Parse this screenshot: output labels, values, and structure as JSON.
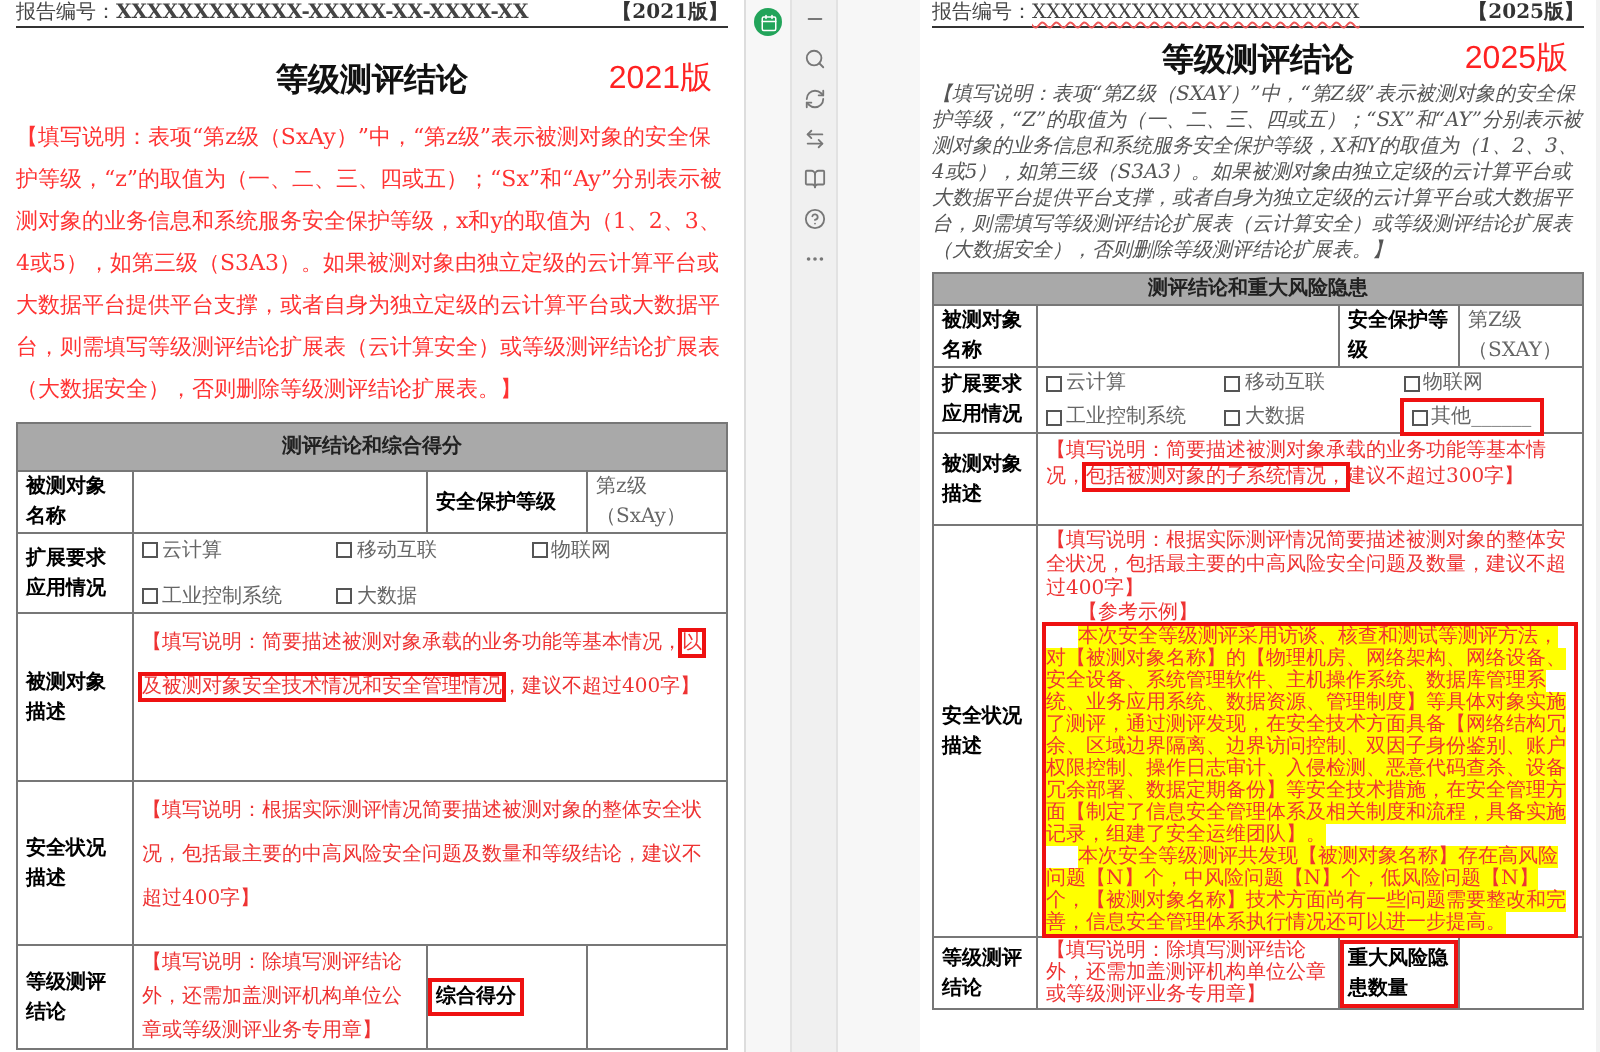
{
  "left_doc": {
    "report_no_label": "报告编号：",
    "report_no": "XXXXXXXXXXXX-XXXXX-XX-XXXX-XX",
    "edition_tag": "【2021版】",
    "title": "等级测评结论",
    "version_label": "2021版",
    "instruction": "【填写说明：表项“第z级（SxAy）”中，“第z级”表示被测对象的安全保护等级，“z”的取值为（一、二、三、四或五）；“Sx”和“Ay”分别表示被测对象的业务信息和系统服务安全保护等级，x和y的取值为（1、2、3、4或5），如第三级（S3A3）。如果被测对象由独立定级的云计算平台或大数据平台提供平台支撑，或者自身为独立定级的云计算平台或大数据平台，则需填写等级测评结论扩展表（云计算安全）或等级测评结论扩展表（大数据安全），否则删除等级测评结论扩展表。】",
    "table": {
      "heading": "测评结论和综合得分",
      "target_name_label": "被测对象名称",
      "protection_label": "安全保护等级",
      "protection_value": "第z级（SxAy）",
      "extension_label": [
        "扩展要求",
        "应用情况"
      ],
      "options": [
        {
          "label": "云计算",
          "checked": false,
          "boxed": false
        },
        {
          "label": "移动互联",
          "checked": false,
          "boxed": false
        },
        {
          "label": "物联网",
          "checked": false,
          "boxed": false
        },
        {
          "label": "工业控制系统",
          "checked": false,
          "boxed": false
        },
        {
          "label": "大数据",
          "checked": false,
          "boxed": false
        }
      ],
      "desc_label": "被测对象描述",
      "desc_note": [
        {
          "text": "【填写说明：简要描述被测对象承载的业务功能等基本情况，",
          "boxed": false
        },
        {
          "text": "以及被测对象安全技术情况和安全管理情况",
          "boxed": true
        },
        {
          "text": "，建议不超过400字】",
          "boxed": false
        }
      ],
      "status_label": "安全状况描述",
      "status_note": "【填写说明：根据实际测评情况简要描述被测对象的整体安全状况，包括最主要的中高风险安全问题及数量和等级结论，建议不超过400字】",
      "conclusion_label": "等级测评结论",
      "conclusion_note": "【填写说明：除填写测评结论外，还需加盖测评机构单位公章或等级测评业务专用章】",
      "score_label": "综合得分",
      "score_boxed": true
    }
  },
  "right_doc": {
    "report_no_label": "报告编号：",
    "report_no": "XXXXXXXXXXXXXXXXXXXXXXX",
    "edition_tag": "【2025版】",
    "title": "等级测评结论",
    "version_label": "2025版",
    "instruction": "【填写说明：表项“第Z级（SXAY）”中，“第Z级”表示被测对象的安全保护等级，“Z”的取值为（一、二、三、四或五）；“SX”和“AY”分别表示被测对象的业务信息和系统服务安全保护等级，X和Y的取值为（1、2、3、4或5），如第三级（S3A3）。如果被测对象由独立定级的云计算平台或大数据平台提供平台支撑，或者自身为独立定级的云计算平台或大数据平台，则需填写等级测评结论扩展表（云计算安全）或等级测评结论扩展表（大数据安全），否则删除等级测评结论扩展表。】",
    "table": {
      "heading": "测评结论和重大风险隐患",
      "target_name_label": "被测对象名称",
      "protection_label": "安全保护等级",
      "protection_value": "第Z级（SXAY）",
      "extension_label": [
        "扩展要求",
        "应用情况"
      ],
      "options": [
        {
          "label": "云计算",
          "checked": false,
          "boxed": false
        },
        {
          "label": "移动互联",
          "checked": false,
          "boxed": false
        },
        {
          "label": "物联网",
          "checked": false,
          "boxed": false
        },
        {
          "label": "工业控制系统",
          "checked": false,
          "boxed": false
        },
        {
          "label": "大数据",
          "checked": false,
          "boxed": false
        },
        {
          "label": "其他______",
          "checked": false,
          "boxed": true
        }
      ],
      "desc_label": "被测对象描述",
      "desc_note": [
        {
          "text": "【填写说明：简要描述被测对象承载的业务功能等基本情况，",
          "boxed": false
        },
        {
          "text": "包括被测对象的子系统情况，",
          "boxed": true
        },
        {
          "text": "建议不超过300字】",
          "boxed": false
        }
      ],
      "status_label": "安全状况描述",
      "status_note": "【填写说明：根据实际测评情况简要描述被测对象的整体安全状况，包括最主要的中高风险安全问题及数量，建议不超过400字】",
      "example_heading": "【参考示例】",
      "example_boxed": true,
      "example_paragraphs": [
        "本次安全等级测评采用访谈、核查和测试等测评方法，对【被测对象名称】的【物理机房、网络架构、网络设备、安全设备、系统管理软件、主机操作系统、数据库管理系统、业务应用系统、数据资源、管理制度】等具体对象实施了测评，通过测评发现，在安全技术方面具备【网络结构冗余、区域边界隔离、边界访问控制、双因子身份鉴别、账户权限控制、操作日志审计、入侵检测、恶意代码查杀、设备冗余部署、数据定期备份】等安全技术措施，在安全管理方面【制定了信息安全管理体系及相关制度和流程，具备实施记录，组建了安全运维团队】。",
        "本次安全等级测评共发现【被测对象名称】存在高风险问题【N】个，中风险问题【N】个，低风险问题【N】个，【被测对象名称】技术方面尚有一些问题需要整改和完善，信息安全管理体系执行情况还可以进一步提高。"
      ],
      "conclusion_label": "等级测评结论",
      "conclusion_note": "【填写说明：除填写测评结论外，还需加盖测评机构单位公章或等级测评业务专用章】",
      "score_label": "重大风险隐患数量",
      "score_boxed": true
    }
  },
  "toolbar": [
    {
      "kind": "minus"
    },
    {
      "kind": "search"
    },
    {
      "kind": "refresh"
    },
    {
      "kind": "swap"
    },
    {
      "kind": "book"
    },
    {
      "kind": "help"
    },
    {
      "kind": "more"
    }
  ]
}
